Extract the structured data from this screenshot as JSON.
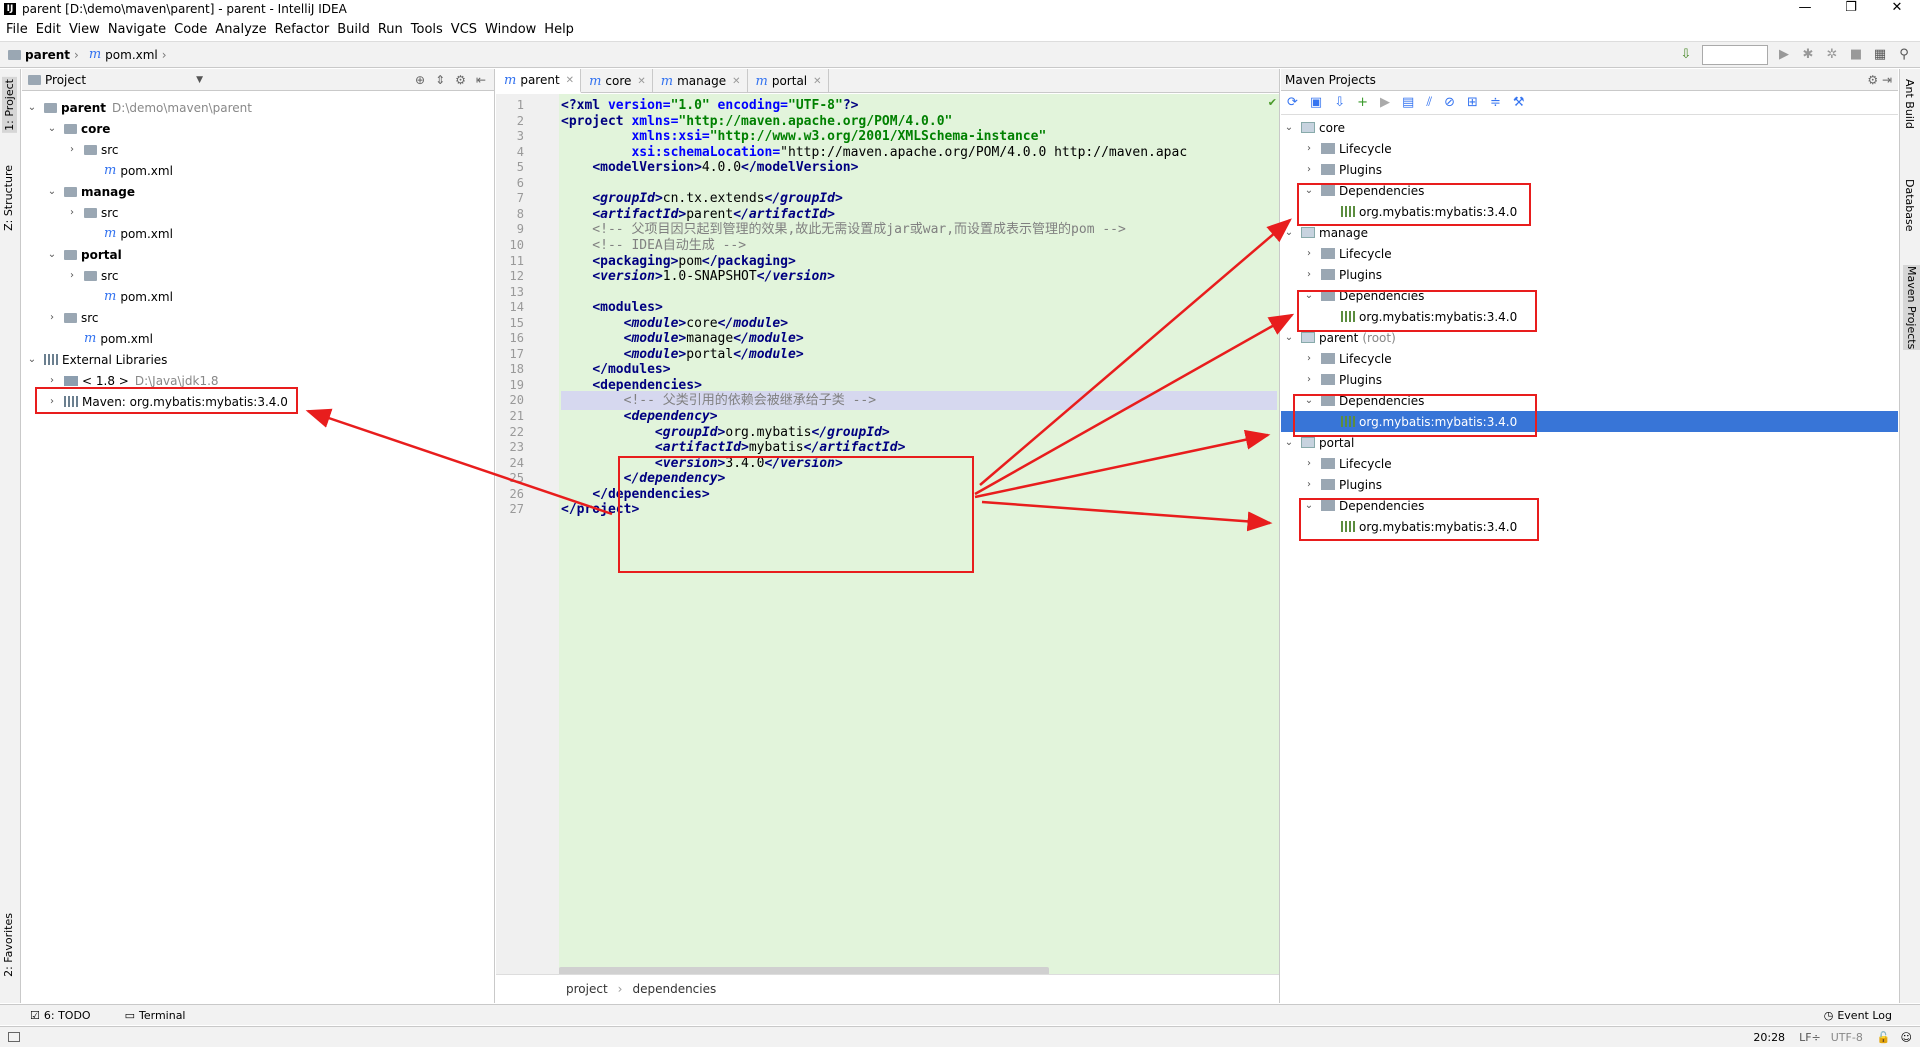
{
  "window": {
    "title": "parent [D:\\demo\\maven\\parent] - parent - IntelliJ IDEA",
    "app_icon": "IJ",
    "buttons": [
      "—",
      "❐",
      "✕"
    ]
  },
  "menu": [
    "File",
    "Edit",
    "View",
    "Navigate",
    "Code",
    "Analyze",
    "Refactor",
    "Build",
    "Run",
    "Tools",
    "VCS",
    "Window",
    "Help"
  ],
  "breadcrumb": {
    "root": "parent",
    "file": "pom.xml"
  },
  "left_tabs": {
    "project": "1: Project",
    "structure": "Z: Structure",
    "favorites": "2: Favorites"
  },
  "right_tabs": {
    "ant": "Ant Build",
    "database": "Database",
    "maven": "Maven Projects"
  },
  "project_panel": {
    "title": "Project",
    "tree": [
      {
        "label": "parent",
        "path": "D:\\demo\\maven\\parent",
        "indent": 0,
        "arrow": "⌄",
        "icon": "folder",
        "bold": true
      },
      {
        "label": "core",
        "indent": 1,
        "arrow": "⌄",
        "icon": "folder",
        "bold": true
      },
      {
        "label": "src",
        "indent": 2,
        "arrow": "›",
        "icon": "folder"
      },
      {
        "label": "pom.xml",
        "indent": 3,
        "arrow": "",
        "icon": "maven"
      },
      {
        "label": "manage",
        "indent": 1,
        "arrow": "⌄",
        "icon": "folder",
        "bold": true
      },
      {
        "label": "src",
        "indent": 2,
        "arrow": "›",
        "icon": "folder"
      },
      {
        "label": "pom.xml",
        "indent": 3,
        "arrow": "",
        "icon": "maven"
      },
      {
        "label": "portal",
        "indent": 1,
        "arrow": "⌄",
        "icon": "folder",
        "bold": true
      },
      {
        "label": "src",
        "indent": 2,
        "arrow": "›",
        "icon": "folder"
      },
      {
        "label": "pom.xml",
        "indent": 3,
        "arrow": "",
        "icon": "maven"
      },
      {
        "label": "src",
        "indent": 1,
        "arrow": "›",
        "icon": "folder"
      },
      {
        "label": "pom.xml",
        "indent": 2,
        "arrow": "",
        "icon": "maven"
      },
      {
        "label": "External Libraries",
        "indent": 0,
        "arrow": "⌄",
        "icon": "lib"
      },
      {
        "label": "< 1.8 >",
        "path": "D:\\Java\\jdk1.8",
        "indent": 1,
        "arrow": "›",
        "icon": "jdk"
      },
      {
        "label": "Maven: org.mybatis:mybatis:3.4.0",
        "indent": 1,
        "arrow": "›",
        "icon": "lib"
      }
    ]
  },
  "editor": {
    "tabs": [
      {
        "label": "parent",
        "active": true
      },
      {
        "label": "core"
      },
      {
        "label": "manage"
      },
      {
        "label": "portal"
      }
    ],
    "lines": [
      "<?xml version=\"1.0\" encoding=\"UTF-8\"?>",
      "<project xmlns=\"http://maven.apache.org/POM/4.0.0\"",
      "         xmlns:xsi=\"http://www.w3.org/2001/XMLSchema-instance\"",
      "         xsi:schemaLocation=\"http://maven.apache.org/POM/4.0.0 http://maven.apac",
      "    <modelVersion>4.0.0</modelVersion>",
      "",
      "    <groupId>cn.tx.extends</groupId>",
      "    <artifactId>parent</artifactId>",
      "    <!-- 父项目因只起到管理的效果,故此无需设置成jar或war,而设置成表示管理的pom -->",
      "    <!-- IDEA自动生成 -->",
      "    <packaging>pom</packaging>",
      "    <version>1.0-SNAPSHOT</version>",
      "",
      "    <modules>",
      "        <module>core</module>",
      "        <module>manage</module>",
      "        <module>portal</module>",
      "    </modules>",
      "    <dependencies>",
      "        <!-- 父类引用的依赖会被继承给子类 -->",
      "        <dependency>",
      "            <groupId>org.mybatis</groupId>",
      "            <artifactId>mybatis</artifactId>",
      "            <version>3.4.0</version>",
      "        </dependency>",
      "    </dependencies>",
      "</project>"
    ],
    "status_breadcrumb": [
      "project",
      "dependencies"
    ]
  },
  "maven_panel": {
    "title": "Maven Projects",
    "rows": [
      {
        "label": "core",
        "indent": 0,
        "arrow": "⌄",
        "icon": "proj"
      },
      {
        "label": "Lifecycle",
        "indent": 1,
        "arrow": "›",
        "icon": "folder"
      },
      {
        "label": "Plugins",
        "indent": 1,
        "arrow": "›",
        "icon": "folder"
      },
      {
        "label": "Dependencies",
        "indent": 1,
        "arrow": "⌄",
        "icon": "folder"
      },
      {
        "label": "org.mybatis:mybatis:3.4.0",
        "indent": 2,
        "arrow": "",
        "icon": "lib"
      },
      {
        "label": "manage",
        "indent": 0,
        "arrow": "⌄",
        "icon": "proj"
      },
      {
        "label": "Lifecycle",
        "indent": 1,
        "arrow": "›",
        "icon": "folder"
      },
      {
        "label": "Plugins",
        "indent": 1,
        "arrow": "›",
        "icon": "folder"
      },
      {
        "label": "Dependencies",
        "indent": 1,
        "arrow": "⌄",
        "icon": "folder"
      },
      {
        "label": "org.mybatis:mybatis:3.4.0",
        "indent": 2,
        "arrow": "",
        "icon": "lib"
      },
      {
        "label": "parent",
        "suffix": "(root)",
        "indent": 0,
        "arrow": "⌄",
        "icon": "proj"
      },
      {
        "label": "Lifecycle",
        "indent": 1,
        "arrow": "›",
        "icon": "folder"
      },
      {
        "label": "Plugins",
        "indent": 1,
        "arrow": "›",
        "icon": "folder"
      },
      {
        "label": "Dependencies",
        "indent": 1,
        "arrow": "⌄",
        "icon": "folder"
      },
      {
        "label": "org.mybatis:mybatis:3.4.0",
        "indent": 2,
        "arrow": "",
        "icon": "lib",
        "selected": true
      },
      {
        "label": "portal",
        "indent": 0,
        "arrow": "⌄",
        "icon": "proj"
      },
      {
        "label": "Lifecycle",
        "indent": 1,
        "arrow": "›",
        "icon": "folder"
      },
      {
        "label": "Plugins",
        "indent": 1,
        "arrow": "›",
        "icon": "folder"
      },
      {
        "label": "Dependencies",
        "indent": 1,
        "arrow": "⌄",
        "icon": "folder"
      },
      {
        "label": "org.mybatis:mybatis:3.4.0",
        "indent": 2,
        "arrow": "",
        "icon": "lib"
      }
    ]
  },
  "bottom": {
    "todo": "6: TODO",
    "terminal": "Terminal",
    "event_log": "Event Log"
  },
  "status": {
    "time": "20:28",
    "line_sep": "LF÷",
    "encoding": "UTF-8"
  },
  "colors": {
    "annotation": "#e81d1d",
    "selection": "#3875d7",
    "editor_bg": "#e2f4db"
  }
}
